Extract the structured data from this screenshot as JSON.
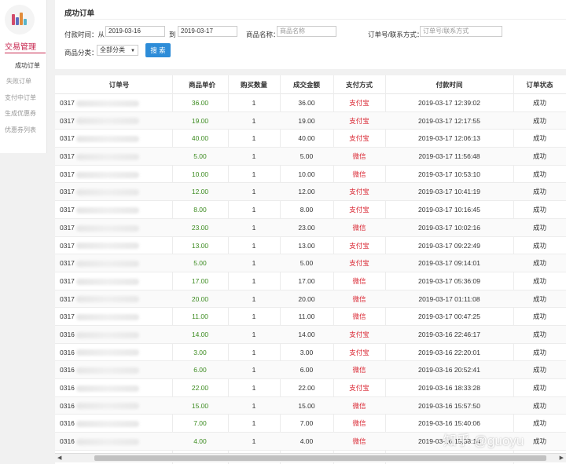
{
  "sidebar": {
    "menu_title": "交易管理",
    "items": [
      {
        "label": "成功订单",
        "active": true
      },
      {
        "label": "失败订单",
        "active": false
      },
      {
        "label": "支付中订单",
        "active": false
      },
      {
        "label": "生成优惠券",
        "active": false
      },
      {
        "label": "优惠券列表",
        "active": false
      }
    ]
  },
  "filter": {
    "title": "成功订单",
    "pay_time_label": "付款时间：从",
    "date_from": "2019-03-16",
    "to_label": "到",
    "date_to": "2019-03-17",
    "product_name_label": "商品名称：",
    "product_name_placeholder": "商品名称",
    "order_contact_label": "订单号/联系方式：",
    "order_contact_placeholder": "订单号/联系方式",
    "category_label": "商品分类：",
    "category_selected": "全部分类",
    "search_button": "搜 索"
  },
  "table": {
    "columns": [
      "订单号",
      "商品单价",
      "购买数量",
      "成交金额",
      "支付方式",
      "付款时间",
      "订单状态"
    ],
    "rows": [
      {
        "order": "0317",
        "price": "36.00",
        "qty": "1",
        "amount": "36.00",
        "pay": "支付宝",
        "time": "2019-03-17 12:39:02",
        "status": "成功"
      },
      {
        "order": "0317",
        "price": "19.00",
        "qty": "1",
        "amount": "19.00",
        "pay": "支付宝",
        "time": "2019-03-17 12:17:55",
        "status": "成功"
      },
      {
        "order": "0317",
        "price": "40.00",
        "qty": "1",
        "amount": "40.00",
        "pay": "支付宝",
        "time": "2019-03-17 12:06:13",
        "status": "成功"
      },
      {
        "order": "0317",
        "price": "5.00",
        "qty": "1",
        "amount": "5.00",
        "pay": "微信",
        "time": "2019-03-17 11:56:48",
        "status": "成功"
      },
      {
        "order": "0317",
        "price": "10.00",
        "qty": "1",
        "amount": "10.00",
        "pay": "微信",
        "time": "2019-03-17 10:53:10",
        "status": "成功"
      },
      {
        "order": "0317",
        "price": "12.00",
        "qty": "1",
        "amount": "12.00",
        "pay": "支付宝",
        "time": "2019-03-17 10:41:19",
        "status": "成功"
      },
      {
        "order": "0317",
        "price": "8.00",
        "qty": "1",
        "amount": "8.00",
        "pay": "支付宝",
        "time": "2019-03-17 10:16:45",
        "status": "成功"
      },
      {
        "order": "0317",
        "price": "23.00",
        "qty": "1",
        "amount": "23.00",
        "pay": "微信",
        "time": "2019-03-17 10:02:16",
        "status": "成功"
      },
      {
        "order": "0317",
        "price": "13.00",
        "qty": "1",
        "amount": "13.00",
        "pay": "支付宝",
        "time": "2019-03-17 09:22:49",
        "status": "成功"
      },
      {
        "order": "0317",
        "price": "5.00",
        "qty": "1",
        "amount": "5.00",
        "pay": "支付宝",
        "time": "2019-03-17 09:14:01",
        "status": "成功"
      },
      {
        "order": "0317",
        "price": "17.00",
        "qty": "1",
        "amount": "17.00",
        "pay": "微信",
        "time": "2019-03-17 05:36:09",
        "status": "成功"
      },
      {
        "order": "0317",
        "price": "20.00",
        "qty": "1",
        "amount": "20.00",
        "pay": "微信",
        "time": "2019-03-17 01:11:08",
        "status": "成功"
      },
      {
        "order": "0317",
        "price": "11.00",
        "qty": "1",
        "amount": "11.00",
        "pay": "微信",
        "time": "2019-03-17 00:47:25",
        "status": "成功"
      },
      {
        "order": "0316",
        "price": "14.00",
        "qty": "1",
        "amount": "14.00",
        "pay": "支付宝",
        "time": "2019-03-16 22:46:17",
        "status": "成功"
      },
      {
        "order": "0316",
        "price": "3.00",
        "qty": "1",
        "amount": "3.00",
        "pay": "支付宝",
        "time": "2019-03-16 22:20:01",
        "status": "成功"
      },
      {
        "order": "0316",
        "price": "6.00",
        "qty": "1",
        "amount": "6.00",
        "pay": "微信",
        "time": "2019-03-16 20:52:41",
        "status": "成功"
      },
      {
        "order": "0316",
        "price": "22.00",
        "qty": "1",
        "amount": "22.00",
        "pay": "支付宝",
        "time": "2019-03-16 18:33:28",
        "status": "成功"
      },
      {
        "order": "0316",
        "price": "15.00",
        "qty": "1",
        "amount": "15.00",
        "pay": "微信",
        "time": "2019-03-16 15:57:50",
        "status": "成功"
      },
      {
        "order": "0316",
        "price": "7.00",
        "qty": "1",
        "amount": "7.00",
        "pay": "微信",
        "time": "2019-03-16 15:40:06",
        "status": "成功"
      },
      {
        "order": "0316",
        "price": "4.00",
        "qty": "1",
        "amount": "4.00",
        "pay": "微信",
        "time": "2019-03-16 15:38:14",
        "status": "成功"
      }
    ]
  },
  "watermark": "知乎 @guoyu",
  "colors": {
    "price_green": "#3a8a1e",
    "pay_red": "#d9232f",
    "button_blue": "#2d8cd8",
    "menu_red": "#c7254e"
  }
}
